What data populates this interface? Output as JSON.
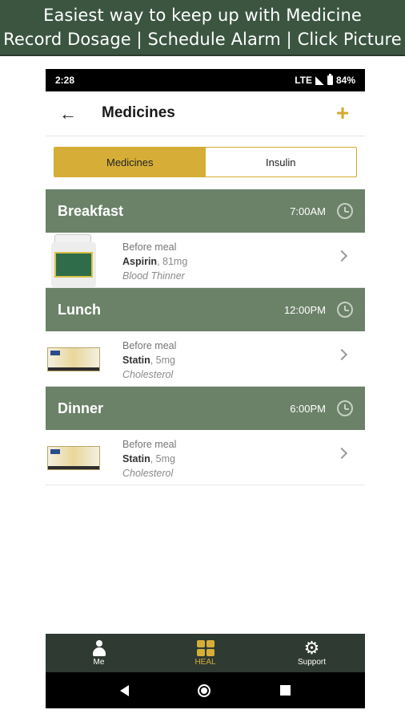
{
  "banner": {
    "line1": "Easiest way to keep up with Medicine",
    "line2": "Record Dosage | Schedule Alarm | Click Picture"
  },
  "status_bar": {
    "time": "2:28",
    "network": "LTE",
    "battery": "84%"
  },
  "app_bar": {
    "title": "Medicines",
    "back_icon": "arrow-left",
    "add_icon": "plus"
  },
  "segment": {
    "tabs": [
      {
        "label": "Medicines",
        "active": true
      },
      {
        "label": "Insulin",
        "active": false
      }
    ]
  },
  "meals": [
    {
      "name": "Breakfast",
      "time": "7:00AM",
      "medicine": {
        "timing": "Before meal",
        "name": "Aspirin",
        "dose": ", 81mg",
        "purpose": "Blood Thinner",
        "image": "pill-bottle"
      }
    },
    {
      "name": "Lunch",
      "time": "12:00PM",
      "medicine": {
        "timing": "Before meal",
        "name": "Statin",
        "dose": ", 5mg",
        "purpose": "Cholesterol",
        "image": "pill-box"
      }
    },
    {
      "name": "Dinner",
      "time": "6:00PM",
      "medicine": {
        "timing": "Before meal",
        "name": "Statin",
        "dose": ", 5mg",
        "purpose": "Cholesterol",
        "image": "pill-box"
      }
    }
  ],
  "bottom_nav": [
    {
      "label": "Me",
      "icon": "person",
      "active": false
    },
    {
      "label": "HEAL",
      "icon": "grid",
      "active": true
    },
    {
      "label": "Support",
      "icon": "gear",
      "active": false
    }
  ],
  "colors": {
    "banner": "#3b5541",
    "meal_header": "#6b8268",
    "accent": "#d6ae37",
    "bottom_nav": "#2f3a32"
  }
}
